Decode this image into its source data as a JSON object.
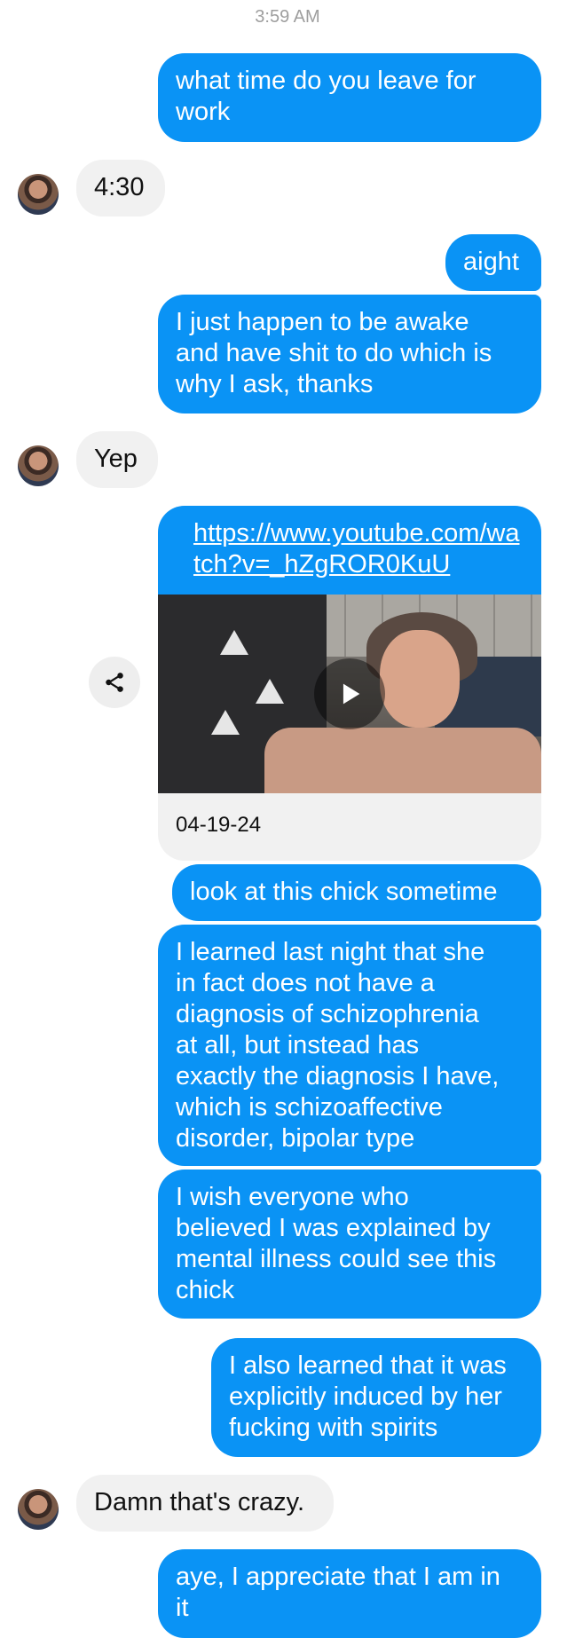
{
  "timestamp": "3:59 AM",
  "messages": [
    {
      "text": "what time do you leave for\nwork"
    },
    {
      "text": "4:30"
    },
    {
      "text": "aight"
    },
    {
      "text": "I just happen to be awake\nand have shit to do which is\nwhy I ask, thanks"
    },
    {
      "text": "Yep"
    },
    {
      "text": "look at this chick sometime"
    },
    {
      "text": "I learned last night that she\nin fact does not have a\ndiagnosis of schizophrenia\nat all, but instead has\nexactly the diagnosis I have,\nwhich is schizoaffective\ndisorder, bipolar type"
    },
    {
      "text": "I wish everyone who\nbelieved I was explained by\nmental illness could see this\nchick"
    },
    {
      "text": "I also learned that it was\nexplicitly induced by her\nfucking with spirits"
    },
    {
      "text": "Damn that's crazy."
    },
    {
      "text": "aye, I appreciate that I am in\nit"
    }
  ],
  "link_preview": {
    "url": "https://www.youtube.com/watch?v=_hZgROR0KuU",
    "date": "04-19-24",
    "icons": {
      "share": "share-icon",
      "play": "play-icon"
    }
  },
  "colors": {
    "outgoing": "#0a93f5",
    "incoming": "#f1f1f1"
  }
}
